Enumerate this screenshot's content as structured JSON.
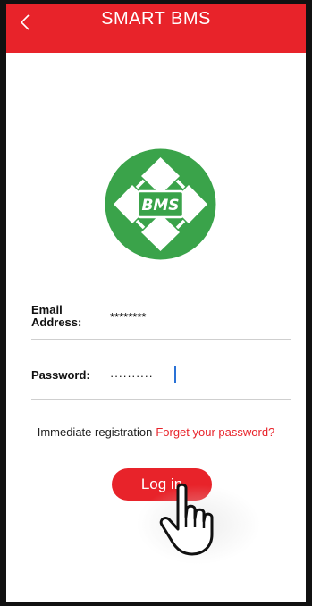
{
  "header": {
    "title": "SMART BMS",
    "background_color": "#e8232a",
    "back_icon": "chevron-left-icon"
  },
  "logo": {
    "text": "BMS",
    "color": "#3aa34a"
  },
  "form": {
    "email": {
      "label": "Email Address:",
      "value": "********"
    },
    "password": {
      "label": "Password:",
      "value": "··········"
    }
  },
  "links": {
    "register": "Immediate registration",
    "forgot": "Forget your password?"
  },
  "login_button": {
    "label": "Log in"
  },
  "overlay": {
    "icon": "pointing-hand-icon"
  }
}
